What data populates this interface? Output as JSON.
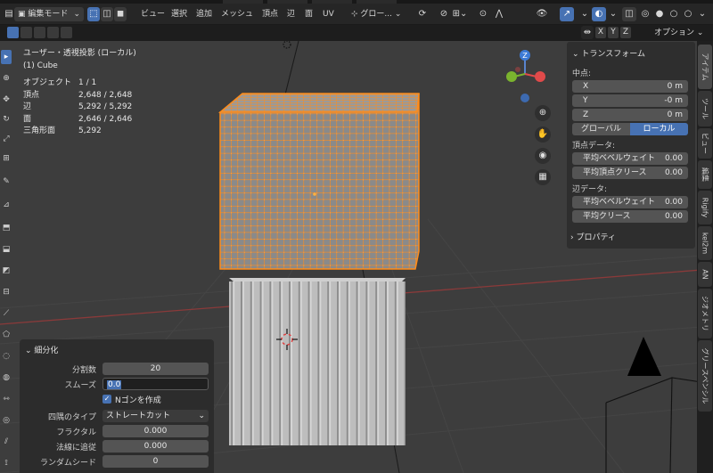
{
  "header": {
    "mode_label": "編集モード",
    "menus": [
      "ビュー",
      "選択",
      "追加",
      "メッシュ",
      "頂点",
      "辺",
      "面",
      "UV"
    ],
    "transform_orientation": "グロー...",
    "options_label": "オプション"
  },
  "axis_buttons": [
    "X",
    "Y",
    "Z"
  ],
  "viewport": {
    "view_name": "ユーザー・透視投影 (ローカル)",
    "object_name": "(1) Cube",
    "stats": [
      {
        "label": "オブジェクト",
        "value": "1 / 1"
      },
      {
        "label": "頂点",
        "value": "2,648 / 2,648"
      },
      {
        "label": "辺",
        "value": "5,292 / 5,292"
      },
      {
        "label": "面",
        "value": "2,646 / 2,646"
      },
      {
        "label": "三角形面",
        "value": "5,292"
      }
    ]
  },
  "gizmo": {
    "x": "X",
    "y": "Y",
    "z": "Z"
  },
  "npanel": {
    "title": "トランスフォーム",
    "median_label": "中点:",
    "median": [
      {
        "axis": "X",
        "value": "0 m"
      },
      {
        "axis": "Y",
        "value": "-0 m"
      },
      {
        "axis": "Z",
        "value": "0 m"
      }
    ],
    "global_label": "グローバル",
    "local_label": "ローカル",
    "vertex_data_label": "頂点データ:",
    "vertex_bevel": {
      "label": "平均ベベルウェイト",
      "value": "0.00"
    },
    "vertex_crease": {
      "label": "平均頂点クリース",
      "value": "0.00"
    },
    "edge_data_label": "辺データ:",
    "edge_bevel": {
      "label": "平均ベベルウェイト",
      "value": "0.00"
    },
    "edge_crease": {
      "label": "平均クリース",
      "value": "0.00"
    },
    "properties_label": "プロパティ"
  },
  "tabs": [
    "アイテム",
    "ツール",
    "ビュー",
    "編集",
    "Rigify",
    "kel2m",
    "AN",
    "ジオメトリ",
    "グリースペンシル"
  ],
  "redo_panel": {
    "title": "細分化",
    "cuts": {
      "label": "分割数",
      "value": "20"
    },
    "smooth": {
      "label": "スムーズ",
      "value": "0.0"
    },
    "ngon": {
      "label": "Nゴンを作成"
    },
    "quad_corner": {
      "label": "四隅のタイプ",
      "value": "ストレートカット"
    },
    "fractal": {
      "label": "フラクタル",
      "value": "0.000"
    },
    "along_normal": {
      "label": "法線に追従",
      "value": "0.000"
    },
    "seed": {
      "label": "ランダムシード",
      "value": "0"
    }
  },
  "colors": {
    "accent": "#4772b3",
    "selected": "#ff8c1a",
    "viewport": "#3d3d3d",
    "panel": "#2e2e2e"
  }
}
